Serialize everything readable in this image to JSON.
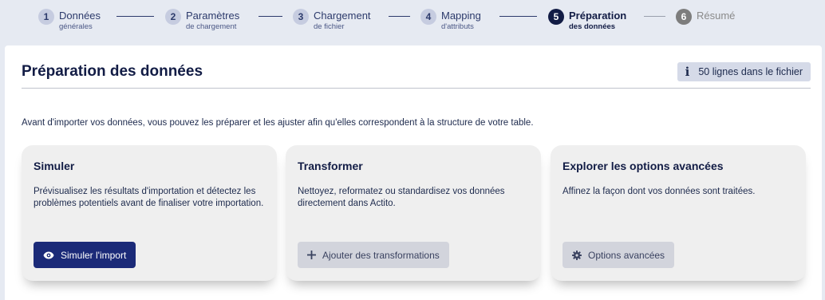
{
  "stepper": {
    "steps": [
      {
        "num": "1",
        "title": "Données",
        "sub": "générales",
        "state": "done"
      },
      {
        "num": "2",
        "title": "Paramètres",
        "sub": "de chargement",
        "state": "done"
      },
      {
        "num": "3",
        "title": "Chargement",
        "sub": "de fichier",
        "state": "done"
      },
      {
        "num": "4",
        "title": "Mapping",
        "sub": "d'attributs",
        "state": "done"
      },
      {
        "num": "5",
        "title": "Préparation",
        "sub": "des données",
        "state": "active"
      },
      {
        "num": "6",
        "title": "Résumé",
        "sub": "",
        "state": "pending"
      }
    ]
  },
  "page": {
    "title": "Préparation des données",
    "info_badge": "50 lignes dans le fichier",
    "info_icon": "i",
    "intro": "Avant d'importer vos données, vous pouvez les préparer et les ajuster afin qu'elles correspondent à la structure de votre table."
  },
  "cards": [
    {
      "title": "Simuler",
      "desc": "Prévisualisez les résultats d'importation et détectez les problèmes potentiels avant de finaliser votre importation.",
      "button": "Simuler l'import",
      "icon": "eye-icon"
    },
    {
      "title": "Transformer",
      "desc": "Nettoyez, reformatez ou standardisez vos données directement dans Actito.",
      "button": "Ajouter des transformations",
      "icon": "plus-icon"
    },
    {
      "title": "Explorer les options avancées",
      "desc": "Affinez la façon dont vos données sont traitées.",
      "button": "Options avancées",
      "icon": "gear-icon"
    }
  ],
  "colors": {
    "primary": "#1b2a78",
    "active_step": "#121c45",
    "background": "#e6eaf2"
  }
}
